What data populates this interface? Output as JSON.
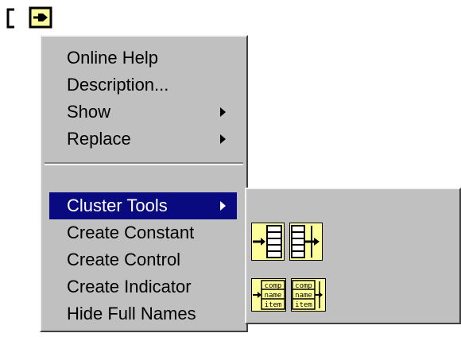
{
  "menu": {
    "items": [
      {
        "label": "Online Help",
        "submenu": false
      },
      {
        "label": "Description...",
        "submenu": false
      },
      {
        "label": "Show",
        "submenu": true
      },
      {
        "label": "Replace",
        "submenu": true
      },
      {
        "label": "Cluster Tools",
        "submenu": true,
        "selected": true
      },
      {
        "label": "Create Constant",
        "submenu": false
      },
      {
        "label": "Create Control",
        "submenu": false
      },
      {
        "label": "Create Indicator",
        "submenu": false
      },
      {
        "label": "Hide Full Names",
        "submenu": false
      }
    ]
  },
  "submenu": {
    "tools": [
      {
        "icon": "bundle-icon"
      },
      {
        "icon": "unbundle-icon"
      },
      {
        "icon": "bundle-by-name-icon",
        "lines": [
          "comp",
          "name",
          "item"
        ]
      },
      {
        "icon": "unbundle-by-name-icon",
        "lines": [
          "comp",
          "name",
          "item"
        ]
      }
    ]
  },
  "colors": {
    "menu_bg": "#c0c0c0",
    "highlight": "#0a0a80",
    "icon_fill": "#ffff99"
  }
}
